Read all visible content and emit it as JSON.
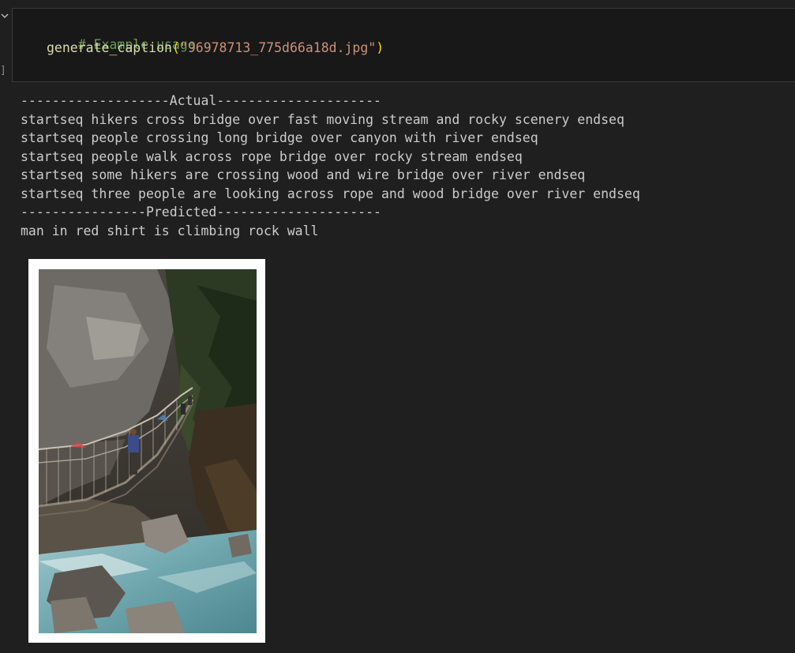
{
  "code_cell": {
    "comment": "# Example usage",
    "function_name": "generate_caption",
    "open_paren": "(",
    "argument": "\"96978713_775d66a18d.jpg\"",
    "close_paren": ")",
    "exec_bracket": "]"
  },
  "output": {
    "actual_header": "-------------------Actual---------------------",
    "actual_captions": [
      "startseq hikers cross bridge over fast moving stream and rocky scenery endseq",
      "startseq people crossing long bridge over canyon with river endseq",
      "startseq people walk across rope bridge over rocky stream endseq",
      "startseq some hikers are crossing wood and wire bridge over river endseq",
      "startseq three people are looking across rope and wood bridge over river endseq"
    ],
    "predicted_header": "----------------Predicted---------------------",
    "predicted_caption": "man in red shirt is climbing rock wall"
  },
  "colors": {
    "background": "#1f1f1f",
    "cell_background": "#181818",
    "comment": "#6a9955",
    "function": "#dcdcaa",
    "paren": "#ffd700",
    "string": "#ce9178",
    "output_text": "#cccccc"
  },
  "icons": {
    "collapse": "chevron-down-icon"
  }
}
